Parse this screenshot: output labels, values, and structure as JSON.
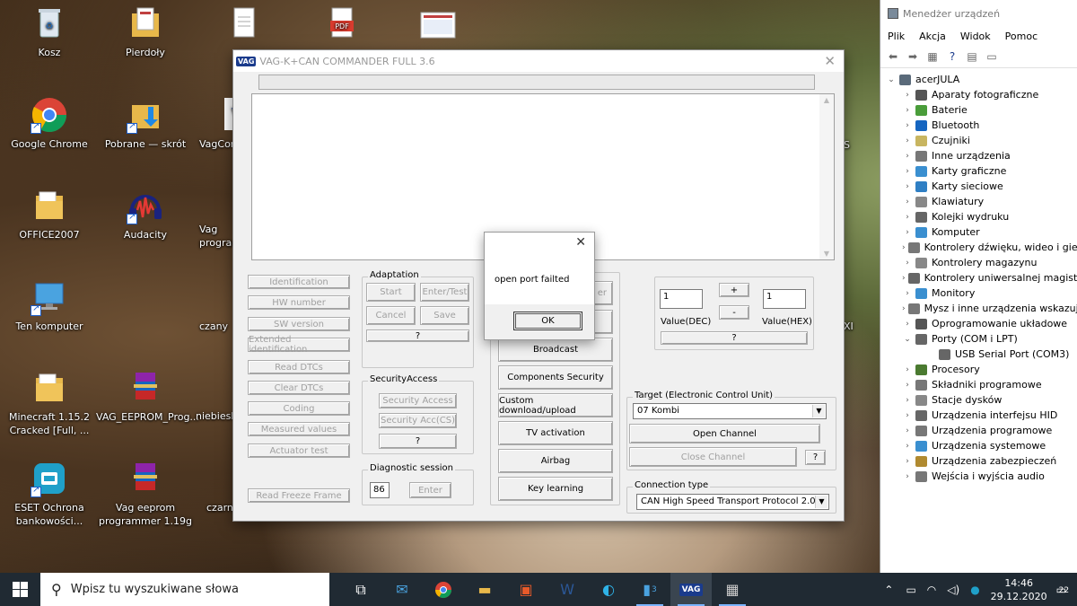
{
  "desktop": {
    "icons": [
      {
        "label": "Kosz"
      },
      {
        "label": "Pierdoły"
      },
      {
        "label": "Google Chrome"
      },
      {
        "label": "Pobrane — skrót"
      },
      {
        "label": "OFFICE2007"
      },
      {
        "label": "Audacity"
      },
      {
        "label": "Ten komputer"
      },
      {
        "label": "Minecraft 1.15.2 Cracked [Full, ..."
      },
      {
        "label": "VAG_EEPROM_Prog..."
      },
      {
        "label": "ESET Ochrona bankowości..."
      },
      {
        "label": "Vag eeprom programmer 1.19g"
      }
    ],
    "partial_labels": {
      "vagcom": "VagCom",
      "vag_prog": "Vag programmer",
      "czany": "czany",
      "niebieski": "niebieski",
      "czarny": "czarny",
      "s_right": "S",
      "xi_right": "XI"
    }
  },
  "vag": {
    "title": "VAG-K+CAN COMMANDER FULL 3.6",
    "logo": "VAG",
    "left_buttons": [
      "Identification",
      "HW number",
      "SW version",
      "Extended identification",
      "Read DTCs",
      "Clear DTCs",
      "Coding",
      "Measured values",
      "Actuator test",
      "Read Freeze Frame"
    ],
    "adaptation": {
      "label": "Adaptation",
      "start": "Start",
      "enter_test": "Enter/Test",
      "cancel": "Cancel",
      "save": "Save",
      "help": "?"
    },
    "security": {
      "label": "SecurityAccess",
      "btn1": "Security Access",
      "btn2": "Security Acc(CS)",
      "help": "?"
    },
    "diagnostic": {
      "label": "Diagnostic session",
      "value": "86",
      "enter": "Enter"
    },
    "middle_buttons": {
      "partial": "er",
      "broadcast": "Broadcast",
      "components": "Components Security",
      "custom": "Custom download/upload",
      "tv": "TV activation",
      "airbag": "Airbag",
      "key": "Key learning"
    },
    "value": {
      "dec": "1",
      "hex": "1",
      "dec_label": "Value(DEC)",
      "hex_label": "Value(HEX)",
      "plus": "+",
      "minus": "-",
      "help": "?"
    },
    "target": {
      "label": "Target (Electronic Control Unit)",
      "selected": "07 Kombi",
      "open": "Open Channel",
      "close": "Close Channel",
      "help": "?"
    },
    "connection": {
      "label": "Connection type",
      "selected": "CAN High Speed Transport Protocol 2.0"
    }
  },
  "dialog": {
    "message": "open port failted",
    "ok": "OK"
  },
  "devmgr": {
    "title": "Menedżer urządzeń",
    "menu": [
      "Plik",
      "Akcja",
      "Widok",
      "Pomoc"
    ],
    "root": "acerJULA",
    "items": [
      {
        "label": "Aparaty fotograficzne",
        "color": "#555555"
      },
      {
        "label": "Baterie",
        "color": "#4a9d3a"
      },
      {
        "label": "Bluetooth",
        "color": "#1565c0"
      },
      {
        "label": "Czujniki",
        "color": "#c8b560"
      },
      {
        "label": "Inne urządzenia",
        "color": "#777777"
      },
      {
        "label": "Karty graficzne",
        "color": "#3a8fd0"
      },
      {
        "label": "Karty sieciowe",
        "color": "#2f7fc4"
      },
      {
        "label": "Klawiatury",
        "color": "#888888"
      },
      {
        "label": "Kolejki wydruku",
        "color": "#666666"
      },
      {
        "label": "Komputer",
        "color": "#3a8fd0"
      },
      {
        "label": "Kontrolery dźwięku, wideo i gier",
        "color": "#777777"
      },
      {
        "label": "Kontrolery magazynu",
        "color": "#888888"
      },
      {
        "label": "Kontrolery uniwersalnej magistrali",
        "color": "#666666"
      },
      {
        "label": "Monitory",
        "color": "#3a8fd0"
      },
      {
        "label": "Mysz i inne urządzenia wskazując",
        "color": "#777777"
      },
      {
        "label": "Oprogramowanie układowe",
        "color": "#555555"
      },
      {
        "label": "Porty (COM i LPT)",
        "color": "#666666"
      },
      {
        "label": "USB Serial Port (COM3)",
        "color": "#666666"
      },
      {
        "label": "Procesory",
        "color": "#4a7a30"
      },
      {
        "label": "Składniki programowe",
        "color": "#777777"
      },
      {
        "label": "Stacje dysków",
        "color": "#888888"
      },
      {
        "label": "Urządzenia interfejsu HID",
        "color": "#666666"
      },
      {
        "label": "Urządzenia programowe",
        "color": "#777777"
      },
      {
        "label": "Urządzenia systemowe",
        "color": "#3a8fd0"
      },
      {
        "label": "Urządzenia zabezpieczeń",
        "color": "#b08a30"
      },
      {
        "label": "Wejścia i wyjścia audio",
        "color": "#777777"
      }
    ]
  },
  "taskbar": {
    "search_placeholder": "Wpisz tu wyszukiwane słowa",
    "time": "14:46",
    "date": "29.12.2020",
    "notification_count": "22",
    "badge_3": "3",
    "vag_label": "VAG"
  }
}
